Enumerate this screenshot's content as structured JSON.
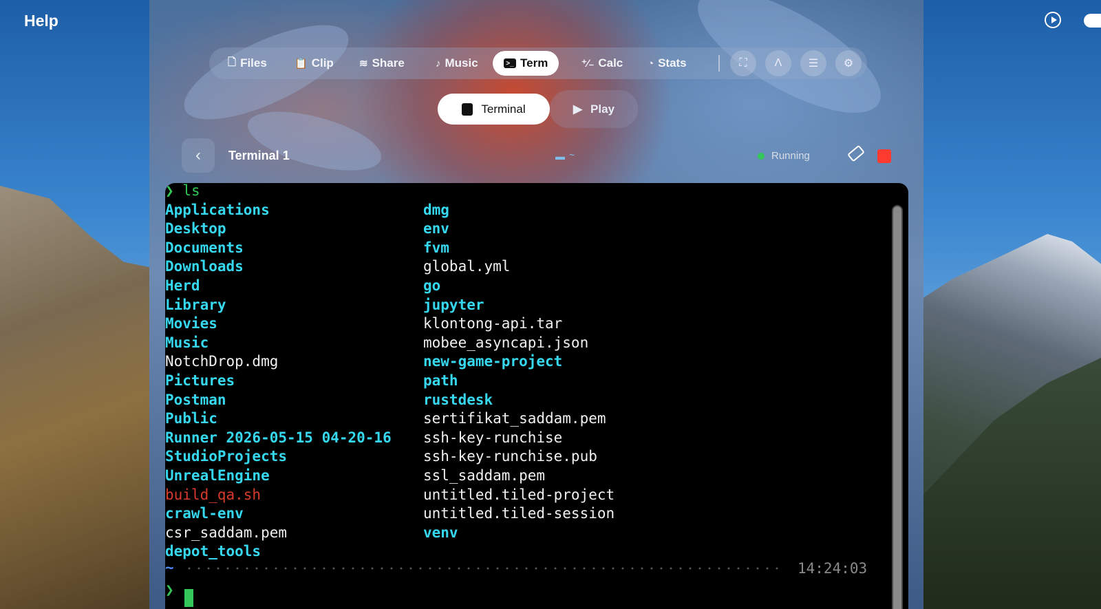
{
  "menubar": {
    "left_label": "Help"
  },
  "tabs": [
    {
      "label": "Files",
      "icon": "file-icon"
    },
    {
      "label": "Clip",
      "icon": "clipboard-icon"
    },
    {
      "label": "Share",
      "icon": "wifi-icon"
    },
    {
      "label": "Music",
      "icon": "music-note-icon"
    },
    {
      "label": "Term",
      "icon": "terminal-icon",
      "active": true
    },
    {
      "label": "Calc",
      "icon": "calculator-icon"
    },
    {
      "label": "Stats",
      "icon": "gauge-icon"
    }
  ],
  "toolbar_icons": [
    "screenshot-icon",
    "pen-icon",
    "stack-icon",
    "gear-icon"
  ],
  "segments": {
    "terminal": "Terminal",
    "play": "Play"
  },
  "session": {
    "title": "Terminal 1",
    "path": "~",
    "status": "Running"
  },
  "terminal": {
    "prompt_symbol": "❯",
    "command": "ls",
    "col1": [
      {
        "name": "Applications",
        "type": "dir"
      },
      {
        "name": "Desktop",
        "type": "dir"
      },
      {
        "name": "Documents",
        "type": "dir"
      },
      {
        "name": "Downloads",
        "type": "dir"
      },
      {
        "name": "Herd",
        "type": "dir"
      },
      {
        "name": "Library",
        "type": "dir"
      },
      {
        "name": "Movies",
        "type": "dir"
      },
      {
        "name": "Music",
        "type": "dir"
      },
      {
        "name": "NotchDrop.dmg",
        "type": "file"
      },
      {
        "name": "Pictures",
        "type": "dir"
      },
      {
        "name": "Postman",
        "type": "dir"
      },
      {
        "name": "Public",
        "type": "dir"
      },
      {
        "name": "Runner 2026-05-15 04-20-16",
        "type": "dir"
      },
      {
        "name": "StudioProjects",
        "type": "dir"
      },
      {
        "name": "UnrealEngine",
        "type": "dir"
      },
      {
        "name": "build_qa.sh",
        "type": "exec"
      },
      {
        "name": "crawl-env",
        "type": "dir"
      },
      {
        "name": "csr_saddam.pem",
        "type": "file"
      },
      {
        "name": "depot_tools",
        "type": "dir"
      }
    ],
    "col2": [
      {
        "name": "dmg",
        "type": "dir"
      },
      {
        "name": "env",
        "type": "dir"
      },
      {
        "name": "fvm",
        "type": "dir"
      },
      {
        "name": "global.yml",
        "type": "file"
      },
      {
        "name": "go",
        "type": "dir"
      },
      {
        "name": "jupyter",
        "type": "dir"
      },
      {
        "name": "klontong-api.tar",
        "type": "file"
      },
      {
        "name": "mobee_asyncapi.json",
        "type": "file"
      },
      {
        "name": "new-game-project",
        "type": "dir"
      },
      {
        "name": "path",
        "type": "dir"
      },
      {
        "name": "rustdesk",
        "type": "dir"
      },
      {
        "name": "sertifikat_saddam.pem",
        "type": "file"
      },
      {
        "name": "ssh-key-runchise",
        "type": "file"
      },
      {
        "name": "ssh-key-runchise.pub",
        "type": "file"
      },
      {
        "name": "ssl_saddam.pem",
        "type": "file"
      },
      {
        "name": "untitled.tiled-project",
        "type": "file"
      },
      {
        "name": "untitled.tiled-session",
        "type": "file"
      },
      {
        "name": "venv",
        "type": "dir"
      }
    ],
    "cwd": "~",
    "time": "14:24:03"
  },
  "colors": {
    "dir": "#35d8ee",
    "file": "#f0f0f0",
    "exec": "#d83a2c",
    "prompt": "#34c759",
    "running": "#34c759",
    "stop": "#ff3b30"
  }
}
